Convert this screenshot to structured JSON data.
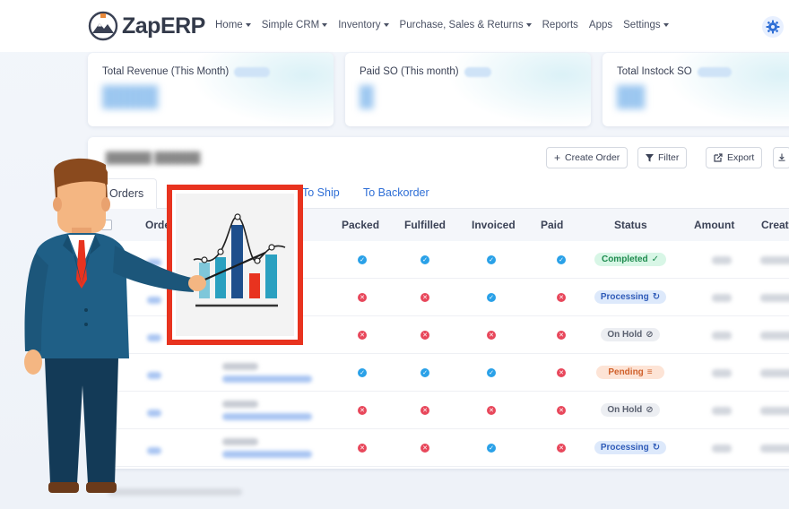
{
  "app": {
    "name": "ZapERP",
    "accent": "#2f6fd6"
  },
  "nav": {
    "items": [
      {
        "label": "Home",
        "dropdown": true
      },
      {
        "label": "Simple CRM",
        "dropdown": true
      },
      {
        "label": "Inventory",
        "dropdown": true
      },
      {
        "label": "Purchase, Sales & Returns",
        "dropdown": true
      },
      {
        "label": "Reports",
        "dropdown": false
      },
      {
        "label": "Apps",
        "dropdown": false
      },
      {
        "label": "Settings",
        "dropdown": true
      }
    ],
    "settings_icon": "gear-icon"
  },
  "stats": [
    {
      "title": "Total Revenue (This Month)"
    },
    {
      "title": "Paid SO (This month)"
    },
    {
      "title": "Total Instock SO"
    }
  ],
  "toolbar": {
    "create_label": "Create Order",
    "filter_label": "Filter",
    "export_label": "Export"
  },
  "tabs": [
    {
      "label": "ll Orders",
      "active": true
    },
    {
      "label": "To Ship",
      "active": false
    },
    {
      "label": "To Backorder",
      "active": false
    }
  ],
  "table": {
    "columns": [
      "Orde",
      "Packed",
      "Fulfilled",
      "Invoiced",
      "Paid",
      "Status",
      "Amount",
      "Creat"
    ],
    "rows": [
      {
        "packed": true,
        "fulfilled": true,
        "invoiced": true,
        "paid": true,
        "status": "Completed",
        "status_type": "completed",
        "status_icon": "check-icon"
      },
      {
        "packed": false,
        "fulfilled": false,
        "invoiced": true,
        "paid": false,
        "status": "Processing",
        "status_type": "processing",
        "status_icon": "refresh-icon"
      },
      {
        "packed": false,
        "fulfilled": false,
        "invoiced": false,
        "paid": false,
        "status": "On Hold",
        "status_type": "onhold",
        "status_icon": "ban-icon"
      },
      {
        "packed": true,
        "fulfilled": true,
        "invoiced": true,
        "paid": false,
        "status": "Pending",
        "status_type": "pending",
        "status_icon": "lines-icon"
      },
      {
        "packed": false,
        "fulfilled": false,
        "invoiced": false,
        "paid": false,
        "status": "On Hold",
        "status_type": "onhold",
        "status_icon": "ban-icon"
      },
      {
        "packed": false,
        "fulfilled": false,
        "invoiced": true,
        "paid": false,
        "status": "Processing",
        "status_type": "processing",
        "status_icon": "refresh-icon"
      }
    ]
  },
  "colors": {
    "ok": "#2aa1e8",
    "fail": "#e8475b",
    "frame": "#e8331f"
  }
}
